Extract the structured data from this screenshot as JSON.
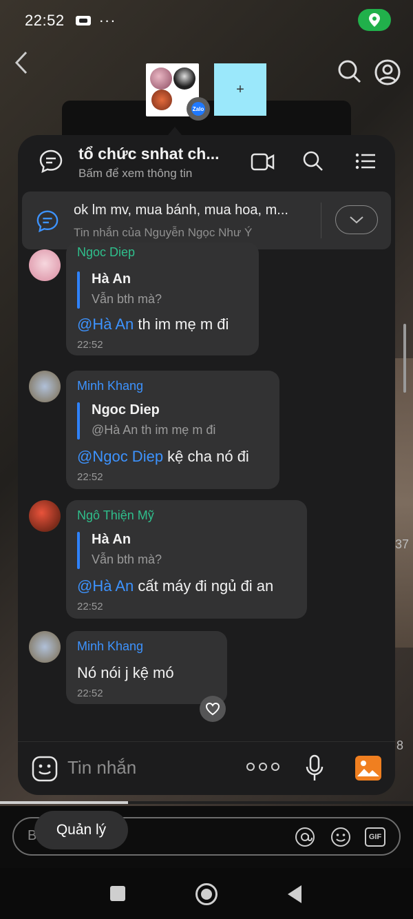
{
  "status": {
    "time": "22:52",
    "dots": "···"
  },
  "chat": {
    "title": "tổ chức snhat ch...",
    "subtitle": "Bấm để xem thông tin",
    "add_label": "+",
    "pinned": {
      "text": "ok lm mv, mua bánh, mua hoa, m...",
      "sub": "Tin nhắn của Nguyễn Ngọc Như Ý"
    },
    "messages": [
      {
        "sender": "Ngoc Diep",
        "quote_name": "Hà An",
        "quote_text": "Vẫn bth mà?",
        "mention": "@Hà An",
        "text": " th im mẹ m đi",
        "time": "22:52"
      },
      {
        "sender": "Minh Khang",
        "quote_name": "Ngoc Diep",
        "quote_text": "@Hà An th im mẹ m đi",
        "mention": "@Ngoc Diep",
        "text": " kệ cha nó đi",
        "time": "22:52"
      },
      {
        "sender": "Ngô Thiện Mỹ",
        "quote_name": "Hà An",
        "quote_text": "Vẫn bth mà?",
        "mention": "@Hà An",
        "text": " cất máy đi ngủ đi an",
        "time": "22:52"
      },
      {
        "sender": "Minh Khang",
        "text": "Nó nói j kệ mó",
        "time": "22:52"
      }
    ],
    "input_placeholder": "Tin nhắn"
  },
  "bottom": {
    "comment_placeholder": "B",
    "manage_label": "Quản lý",
    "gif_label": "GIF",
    "side_count_1": "37",
    "side_count_2": "8"
  },
  "colors": {
    "sender_green": "#2fbf8c",
    "sender_blue": "#3d93ff",
    "mention": "#3d93ff",
    "panel_bg": "#1c1c1d",
    "bubble_bg": "#323233",
    "location_pill": "#21b04b"
  },
  "icons": [
    "back-icon",
    "search-icon",
    "user-icon",
    "chat-icon",
    "video-call-icon",
    "menu-icon",
    "chevron-down-icon",
    "heart-icon",
    "emoji-icon",
    "more-icon",
    "mic-icon",
    "image-icon",
    "location-icon"
  ]
}
